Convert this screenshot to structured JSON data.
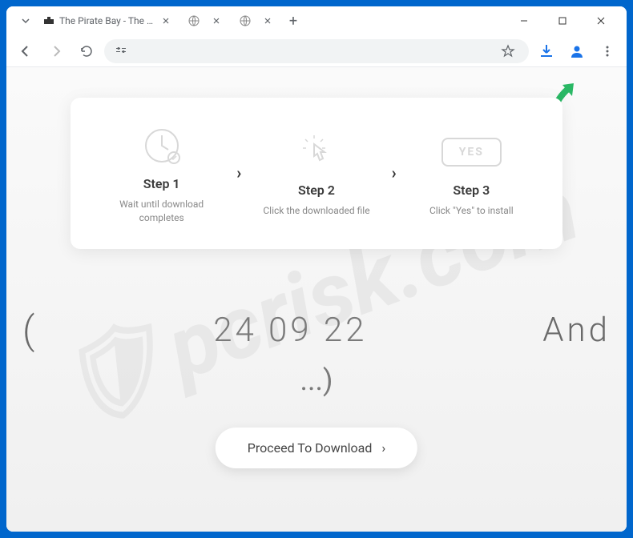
{
  "tabs": [
    {
      "title": "The Pirate Bay - The gala...",
      "favicon": "ship"
    },
    {
      "title": "",
      "favicon": "globe"
    },
    {
      "title": "",
      "favicon": "globe",
      "active": true
    }
  ],
  "steps": [
    {
      "title": "Step 1",
      "desc": "Wait until download completes"
    },
    {
      "title": "Step 2",
      "desc": "Click the downloaded file"
    },
    {
      "title": "Step 3",
      "desc": "Click \"Yes\" to install"
    }
  ],
  "yes_label": "YES",
  "big_text": {
    "left": "(",
    "center": "24 09 22",
    "right": "And",
    "dots": "...)"
  },
  "download_button": "Proceed To Download",
  "watermark": "pcrisk.com"
}
